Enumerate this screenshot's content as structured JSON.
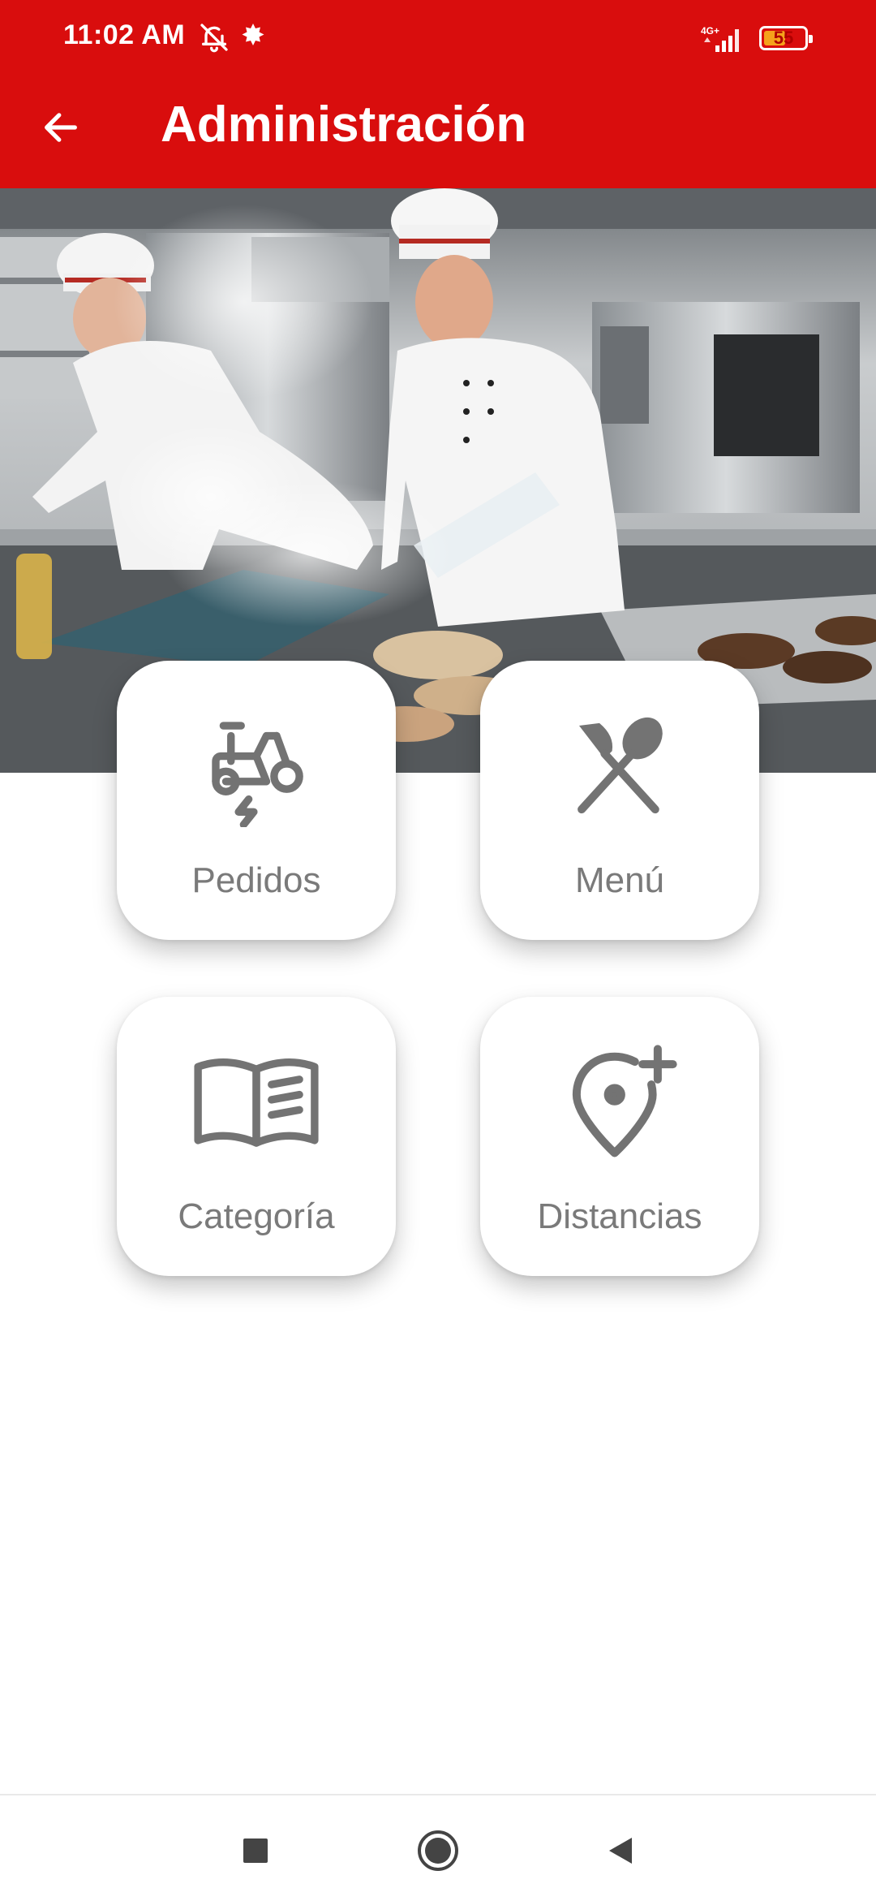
{
  "status_bar": {
    "time": "11:02 AM",
    "network_label": "4G+",
    "battery_level": "55",
    "battery_fraction": 0.55,
    "icons": [
      "bell-off-icon",
      "leaf-notification-icon",
      "signal-icon",
      "battery-icon"
    ]
  },
  "app_bar": {
    "title": "Administración",
    "back_icon": "arrow-left-icon",
    "color": "#d90d0d"
  },
  "hero": {
    "image": "kitchen-chefs-photo"
  },
  "menu": {
    "items": [
      {
        "label": "Pedidos",
        "icon": "delivery-scooter-icon"
      },
      {
        "label": "Menú",
        "icon": "utensils-icon"
      },
      {
        "label": "Categoría",
        "icon": "open-book-icon"
      },
      {
        "label": "Distancias",
        "icon": "location-add-icon"
      }
    ],
    "text_color": "#7a7a7a",
    "icon_color": "#737373"
  },
  "nav_bar": {
    "icons": [
      "recent-apps-icon",
      "home-icon",
      "back-icon"
    ]
  }
}
